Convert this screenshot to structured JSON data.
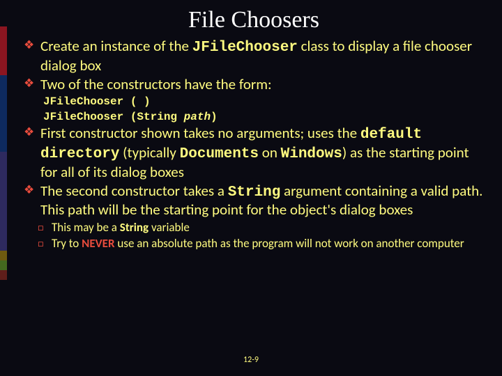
{
  "title": "File Choosers",
  "b1_a": "Create an instance of the ",
  "b1_code": "JFileChooser",
  "b1_b": " class to display a file chooser dialog box",
  "b2": "Two of the constructors have the form:",
  "code1_a": "JFileChooser ( )",
  "code2_a": "JFileChooser (String ",
  "code2_b": "path",
  "code2_c": ")",
  "b3_a": "First constructor shown takes no arguments; uses the ",
  "b3_b": "default directory",
  "b3_c": " (typically ",
  "b3_d": "Documents",
  "b3_e": " on ",
  "b3_f": "Windows",
  "b3_g": ") as the starting point for all of its dialog boxes",
  "b4_a": "The second constructor takes a ",
  "b4_b": "String",
  "b4_c": " argument containing a valid path. This path will be the starting point for the object's dialog boxes",
  "s1_a": "This may be a ",
  "s1_b": "String",
  "s1_c": " variable",
  "s2_a": "Try to ",
  "s2_b": "NEVER",
  "s2_c": " use an absolute path as the program will not work on another computer",
  "page": "12-9"
}
